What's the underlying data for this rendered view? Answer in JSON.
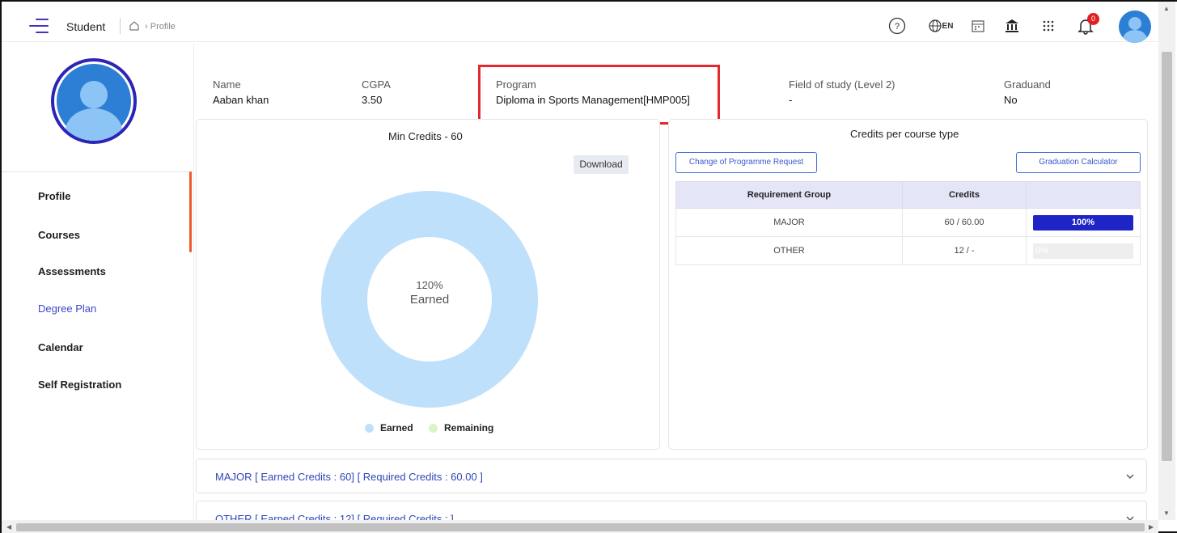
{
  "header": {
    "app_title": "Student",
    "breadcrumb": "Profile",
    "notification_count": "0",
    "language": "EN"
  },
  "sidebar": {
    "items": [
      {
        "label": "Profile"
      },
      {
        "label": "Courses"
      },
      {
        "label": "Assessments"
      },
      {
        "label": "Degree Plan"
      },
      {
        "label": "Calendar"
      },
      {
        "label": "Self Registration"
      }
    ],
    "active_item": "Degree Plan"
  },
  "summary": {
    "name_label": "Name",
    "name_value": "Aaban khan",
    "cgpa_label": "CGPA",
    "cgpa_value": "3.50",
    "program_label": "Program",
    "program_value": "Diploma in Sports Management[HMP005]",
    "field_label": "Field of study (Level 2)",
    "field_value": "-",
    "graduand_label": "Graduand",
    "graduand_value": "No"
  },
  "credits_panel": {
    "title": "Min Credits - 60",
    "download_label": "Download",
    "center_percent": "120%",
    "center_label": "Earned",
    "legend_earned": "Earned",
    "legend_remaining": "Remaining"
  },
  "course_type_panel": {
    "title": "Credits per course type",
    "change_button": "Change of Programme Request",
    "calculator_button": "Graduation Calculator",
    "columns": [
      "Requirement Group",
      "Credits",
      ""
    ],
    "rows": [
      {
        "group": "MAJOR",
        "credits": "60 / 60.00",
        "progress": 100,
        "progress_label": "100%"
      },
      {
        "group": "OTHER",
        "credits": "12 / -",
        "progress": 0,
        "progress_label": "0%"
      }
    ]
  },
  "accordions": [
    {
      "label": "MAJOR [ Earned Credits : 60] [ Required Credits : 60.00 ]"
    },
    {
      "label": "OTHER [ Earned Credits : 12] [ Required Credits : ]"
    }
  ],
  "chart_data": {
    "type": "pie",
    "categories": [
      "Earned",
      "Remaining"
    ],
    "values": [
      120,
      0
    ],
    "title": "Min Credits - 60",
    "colors": [
      "#bfe0fb",
      "#d9f5c5"
    ]
  },
  "colors": {
    "accent": "#3b47c9",
    "highlight_border": "#e5282f",
    "progress_fill": "#1f24c7",
    "nav_accent": "#f05a28",
    "donut": "#bfe0fb",
    "remaining": "#d9f5c5"
  }
}
